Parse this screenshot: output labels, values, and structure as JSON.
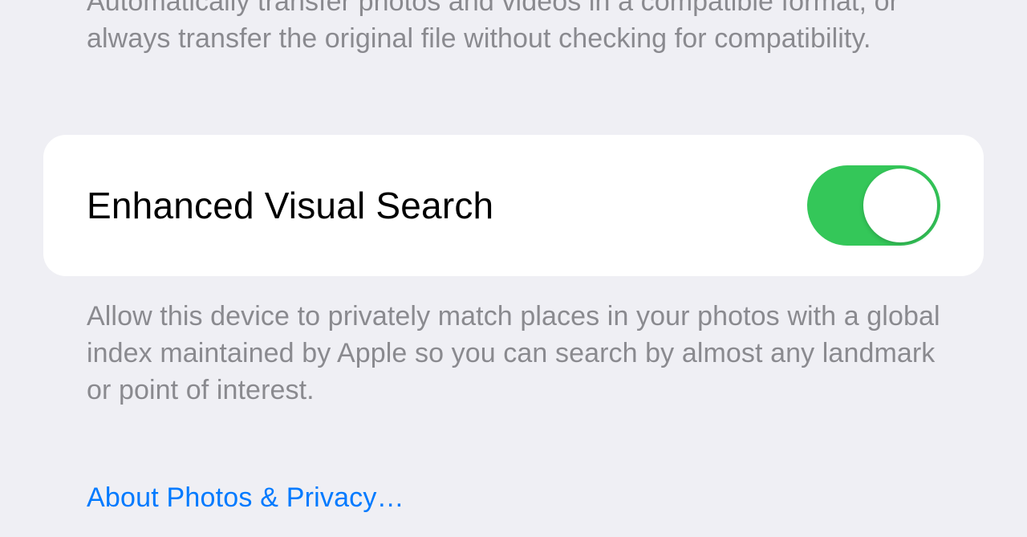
{
  "transfer": {
    "footer": "Automatically transfer photos and videos in a compatible format, or always transfer the original file without checking for compatibility."
  },
  "visualSearch": {
    "label": "Enhanced Visual Search",
    "enabled": true,
    "footer": "Allow this device to privately match places in your photos with a global index maintained by Apple so you can search by almost any landmark or point of interest."
  },
  "privacyLink": {
    "label": "About Photos & Privacy…"
  },
  "colors": {
    "toggleOn": "#34c759",
    "link": "#007aff",
    "background": "#efeff4",
    "secondaryText": "#8a8a8f"
  }
}
